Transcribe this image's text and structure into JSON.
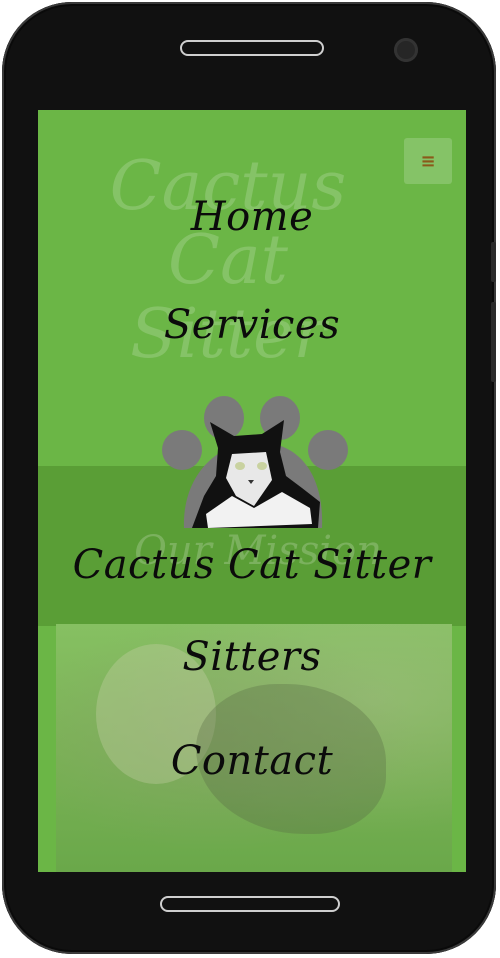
{
  "ghost": {
    "title_lines": [
      "Cactus",
      "Cat",
      "Sitter"
    ],
    "mission": "Our Mission"
  },
  "menu_toggle": {
    "icon": "menu-icon",
    "glyph": "≡"
  },
  "nav": {
    "items": [
      {
        "label": "Home"
      },
      {
        "label": "Services"
      },
      {
        "label": "Cactus Cat Sitter"
      },
      {
        "label": "Sitters"
      },
      {
        "label": "Contact"
      }
    ]
  },
  "colors": {
    "screen_green": "#6bb646",
    "band_green": "#5a9e36",
    "paw_gray": "#7a7a7a",
    "text": "#0b0b0b"
  }
}
